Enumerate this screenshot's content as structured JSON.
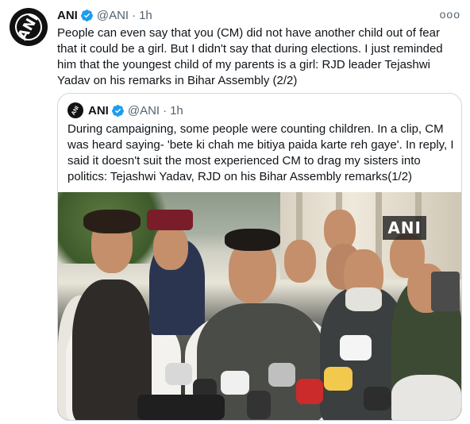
{
  "tweet": {
    "name": "ANI",
    "handle": "@ANI",
    "separator": "·",
    "time": "1h",
    "text": "People can even say that you (CM) did not have another child out of fear that it could be a girl. But I didn't say that during elections. I just reminded him that the youngest child of my parents is a girl: RJD leader Tejashwi Yadav on his remarks in Bihar Assembly (2/2)",
    "more_label": "ooo"
  },
  "quoted": {
    "name": "ANI",
    "handle": "@ANI",
    "separator": "·",
    "time": "1h",
    "text": "During campaigning, some people were counting children. In a clip, CM was heard saying- 'bete ki chah me bitiya paida karte reh gaye'. In reply, I said it doesn't suit the most experienced CM to drag my sisters into politics: Tejashwi Yadav, RJD on his Bihar Assembly remarks(1/2)",
    "watermark": "ANI"
  },
  "avatar_logo": "ANI",
  "colors": {
    "verified": "#1d9bf0",
    "muted": "#536471",
    "border": "#cfd9de"
  }
}
